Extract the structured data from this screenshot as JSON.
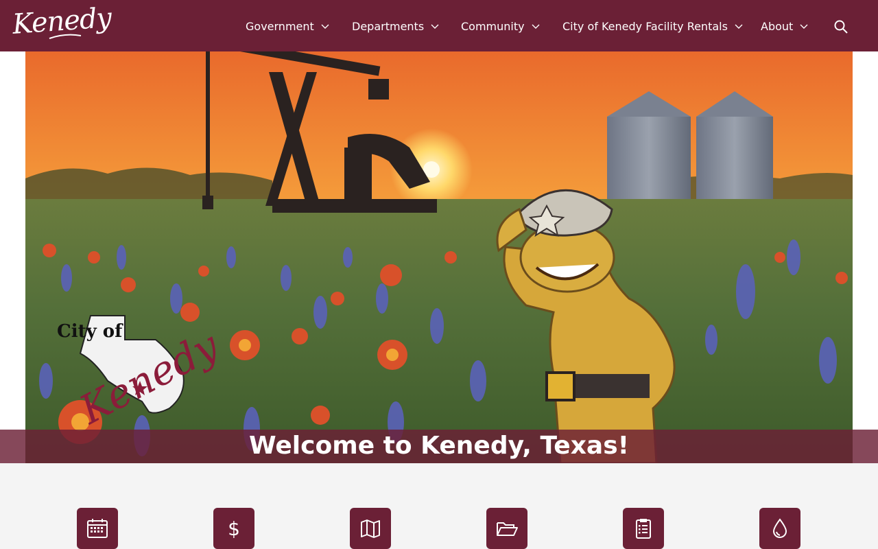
{
  "header": {
    "logo_text": "Kenedy",
    "nav": [
      {
        "label": "Government"
      },
      {
        "label": "Departments"
      },
      {
        "label": "Community"
      },
      {
        "label": "City of Kenedy Facility Rentals"
      },
      {
        "label": "About"
      }
    ],
    "search_icon": "search-icon"
  },
  "hero": {
    "seal_text_top": "City of",
    "seal_text_script": "Kenedy",
    "welcome": "Welcome to Kenedy, Texas!"
  },
  "quick_links": [
    {
      "icon": "calendar-icon"
    },
    {
      "icon": "dollar-icon"
    },
    {
      "icon": "map-icon"
    },
    {
      "icon": "folder-icon"
    },
    {
      "icon": "clipboard-icon"
    },
    {
      "icon": "water-drop-icon"
    }
  ],
  "colors": {
    "brand": "#6b2036",
    "background": "#f4f4f4"
  }
}
